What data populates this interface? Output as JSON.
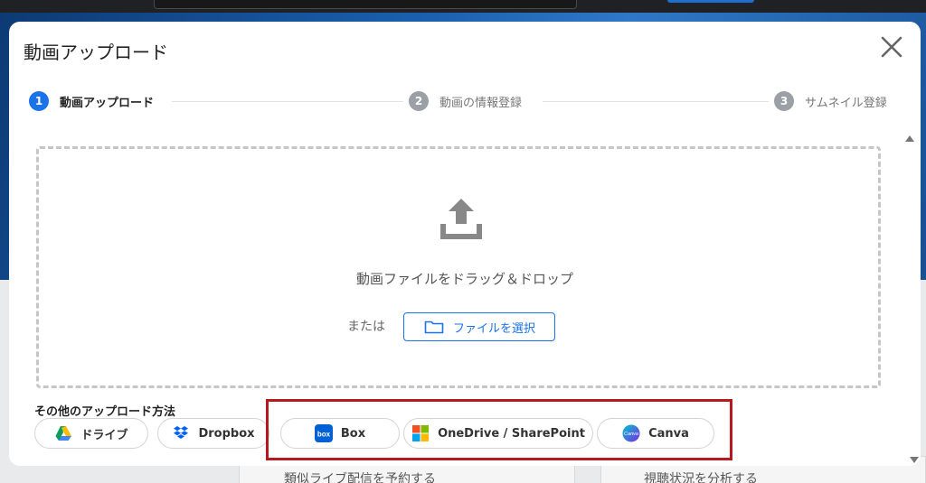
{
  "modal": {
    "title": "動画アップロード",
    "close_icon": "close-icon"
  },
  "steps": [
    {
      "number": "1",
      "label": "動画アップロード",
      "state": "active"
    },
    {
      "number": "2",
      "label": "動画の情報登録",
      "state": "inactive"
    },
    {
      "number": "3",
      "label": "サムネイル登録",
      "state": "inactive"
    }
  ],
  "dropzone": {
    "icon": "upload-icon",
    "instruction": "動画ファイルをドラッグ＆ドロップ",
    "or_text": "または",
    "select_button_label": "ファイルを選択",
    "select_button_icon": "folder-icon"
  },
  "other_methods": {
    "label": "その他のアップロード方法",
    "options": [
      {
        "label": "ドライブ",
        "icon": "google-drive-icon"
      },
      {
        "label": "Dropbox",
        "icon": "dropbox-icon"
      },
      {
        "label": "Box",
        "icon": "box-icon"
      },
      {
        "label": "OneDrive / SharePoint",
        "icon": "microsoft-icon"
      },
      {
        "label": "Canva",
        "icon": "canva-icon"
      }
    ]
  },
  "background": {
    "left_item": "類似ライブ配信を予約する",
    "right_item": "視聴状況を分析する"
  },
  "colors": {
    "accent": "#1a73e8",
    "highlight_border": "#b3191f",
    "inactive_step": "#9aa0a6"
  }
}
